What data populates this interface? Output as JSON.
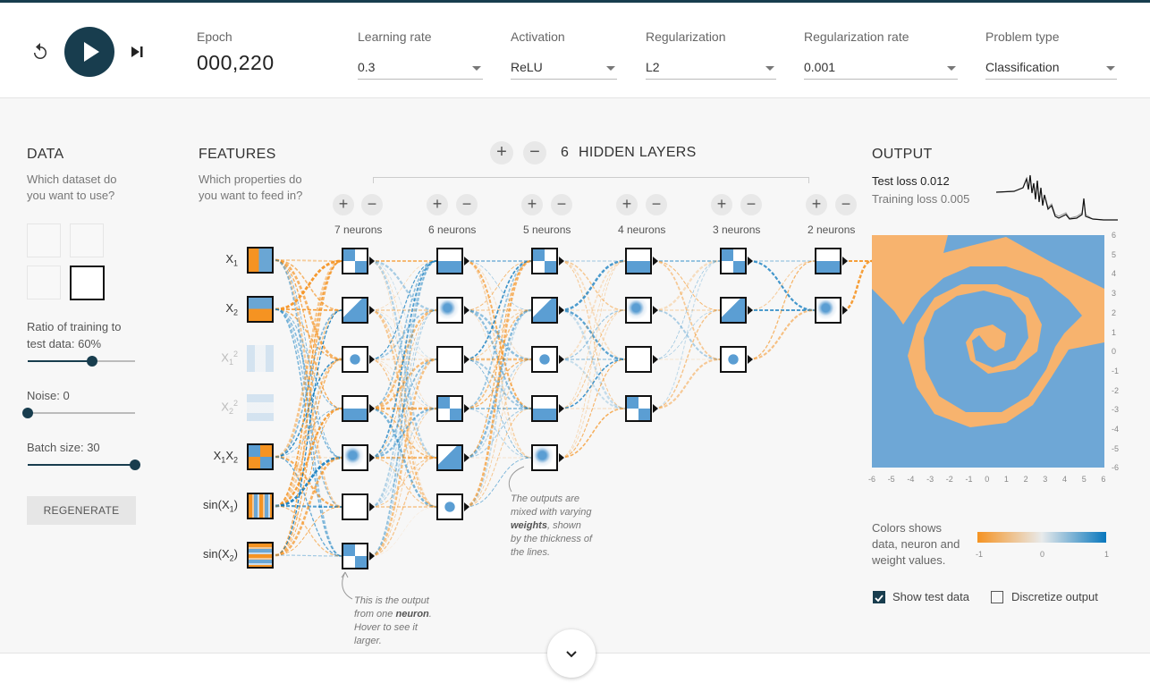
{
  "controls": {
    "epoch_label": "Epoch",
    "epoch_value": "000,220",
    "learning_rate": {
      "label": "Learning rate",
      "value": "0.3"
    },
    "activation": {
      "label": "Activation",
      "value": "ReLU"
    },
    "regularization": {
      "label": "Regularization",
      "value": "L2"
    },
    "regularization_rate": {
      "label": "Regularization rate",
      "value": "0.001"
    },
    "problem_type": {
      "label": "Problem type",
      "value": "Classification"
    }
  },
  "data_panel": {
    "title": "DATA",
    "subtitle_1": "Which dataset do",
    "subtitle_2": "you want to use?",
    "ratio_label_1": "Ratio of training to",
    "ratio_label_2": "test data:  60%",
    "ratio_value": 0.6,
    "noise_label": "Noise:  0",
    "noise_value": 0,
    "batch_label": "Batch size:  30",
    "batch_value": 1.0,
    "regenerate": "REGENERATE"
  },
  "features_panel": {
    "title": "FEATURES",
    "subtitle_1": "Which properties do",
    "subtitle_2": "you want to feed in?"
  },
  "network": {
    "plus": "+",
    "minus": "−",
    "hidden_layers_count": "6",
    "hidden_layers_label": "HIDDEN LAYERS",
    "layers": [
      {
        "label": "7 neurons"
      },
      {
        "label": "6 neurons"
      },
      {
        "label": "5 neurons"
      },
      {
        "label": "4 neurons"
      },
      {
        "label": "3 neurons"
      },
      {
        "label": "2 neurons"
      }
    ],
    "note_neuron": [
      "This is the output",
      "from one",
      "neuron",
      ". Hover to see it",
      "larger."
    ],
    "note_weights": [
      "The outputs are",
      "mixed with varying",
      "weights",
      ", shown",
      "by the thickness of",
      "the lines."
    ]
  },
  "output_panel": {
    "title": "OUTPUT",
    "test_loss": "Test loss 0.012",
    "training_loss": "Training loss 0.005",
    "y_ticks": [
      "6",
      "5",
      "4",
      "3",
      "2",
      "1",
      "0",
      "-1",
      "-2",
      "-3",
      "-4",
      "-5",
      "-6"
    ],
    "x_ticks": [
      "-6",
      "-5",
      "-4",
      "-3",
      "-2",
      "-1",
      "0",
      "1",
      "2",
      "3",
      "4",
      "5",
      "6"
    ],
    "legend_text": [
      "Colors shows",
      "data, neuron and",
      "weight values."
    ],
    "legend_ticks": [
      "-1",
      "0",
      "1"
    ],
    "show_test_data": "Show test data",
    "discretize": "Discretize output"
  },
  "colors": {
    "orange": "#f59322",
    "blue": "#0877bd",
    "dark": "#183d4e"
  }
}
